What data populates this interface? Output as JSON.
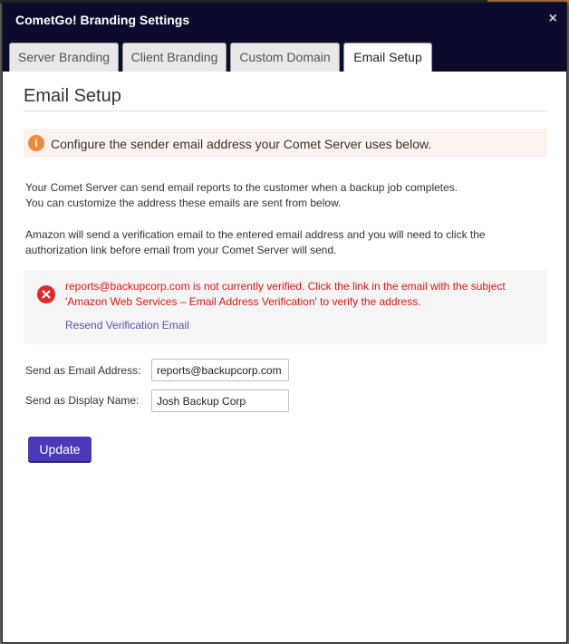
{
  "window": {
    "title": "CometGo! Branding Settings",
    "close_symbol": "×"
  },
  "tabs": [
    {
      "label": "Server Branding",
      "active": false
    },
    {
      "label": "Client Branding",
      "active": false
    },
    {
      "label": "Custom Domain",
      "active": false
    },
    {
      "label": "Email Setup",
      "active": true
    }
  ],
  "page": {
    "heading": "Email Setup"
  },
  "info": {
    "icon": "info-icon",
    "text": "Configure the sender email address your Comet Server uses below."
  },
  "paragraphs": {
    "p1_line1": "Your Comet Server can send email reports to the customer when a backup job completes.",
    "p1_line2": "You can customize the address these emails are sent from below.",
    "p2_line1": "Amazon will send a verification email to the entered email address and you will need to click the",
    "p2_line2": "authorization link before email from your Comet Server will send."
  },
  "error": {
    "icon": "error-x-icon",
    "line1": "reports@backupcorp.com is not currently verified. Click the link in the email with the subject",
    "line2": "'Amazon Web Services – Email Address Verification' to verify the address.",
    "resend_link": "Resend Verification Email"
  },
  "form": {
    "email_label": "Send as Email Address:",
    "email_value": "reports@backupcorp.com",
    "name_label": "Send as Display Name:",
    "name_value": "Josh Backup Corp"
  },
  "buttons": {
    "update": "Update"
  },
  "colors": {
    "titlebar": "#0b0b2e",
    "info_icon": "#ef8a3a",
    "error_text": "#e01515",
    "link": "#5a52b0",
    "primary_button": "#4a39b8"
  }
}
